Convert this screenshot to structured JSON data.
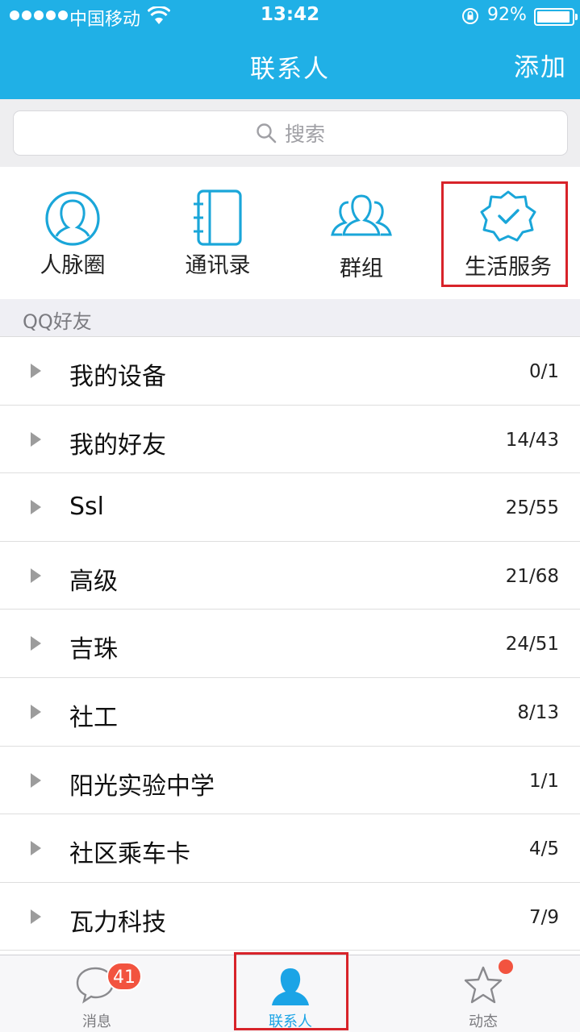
{
  "status_bar": {
    "carrier": "中国移动",
    "time": "13:42",
    "battery_pct": "92%"
  },
  "header": {
    "title": "联系人",
    "add_label": "添加"
  },
  "search": {
    "placeholder": "搜索"
  },
  "quick_entries": [
    {
      "label": "人脉圈",
      "icon": "contacts-circle-icon"
    },
    {
      "label": "通讯录",
      "icon": "address-book-icon"
    },
    {
      "label": "群组",
      "icon": "group-icon"
    },
    {
      "label": "生活服务",
      "icon": "verified-badge-icon",
      "highlighted": true
    }
  ],
  "section": {
    "title": "QQ好友"
  },
  "groups": [
    {
      "name": "我的设备",
      "count": "0/1"
    },
    {
      "name": "我的好友",
      "count": "14/43"
    },
    {
      "name": "Ssl",
      "count": "25/55"
    },
    {
      "name": "高级",
      "count": "21/68"
    },
    {
      "name": "吉珠",
      "count": "24/51"
    },
    {
      "name": "社工",
      "count": "8/13"
    },
    {
      "name": "阳光实验中学",
      "count": "1/1"
    },
    {
      "name": "社区乘车卡",
      "count": "4/5"
    },
    {
      "name": "瓦力科技",
      "count": "7/9"
    }
  ],
  "tabbar": {
    "tabs": [
      {
        "label": "消息",
        "icon": "message-bubble-icon",
        "badge": "41"
      },
      {
        "label": "联系人",
        "icon": "contact-person-icon",
        "active": true,
        "highlighted": true
      },
      {
        "label": "动态",
        "icon": "star-icon",
        "has_dot": true
      }
    ]
  },
  "colors": {
    "brand": "#20b0e6",
    "highlight": "#d8232a",
    "badge": "#f2533f"
  }
}
